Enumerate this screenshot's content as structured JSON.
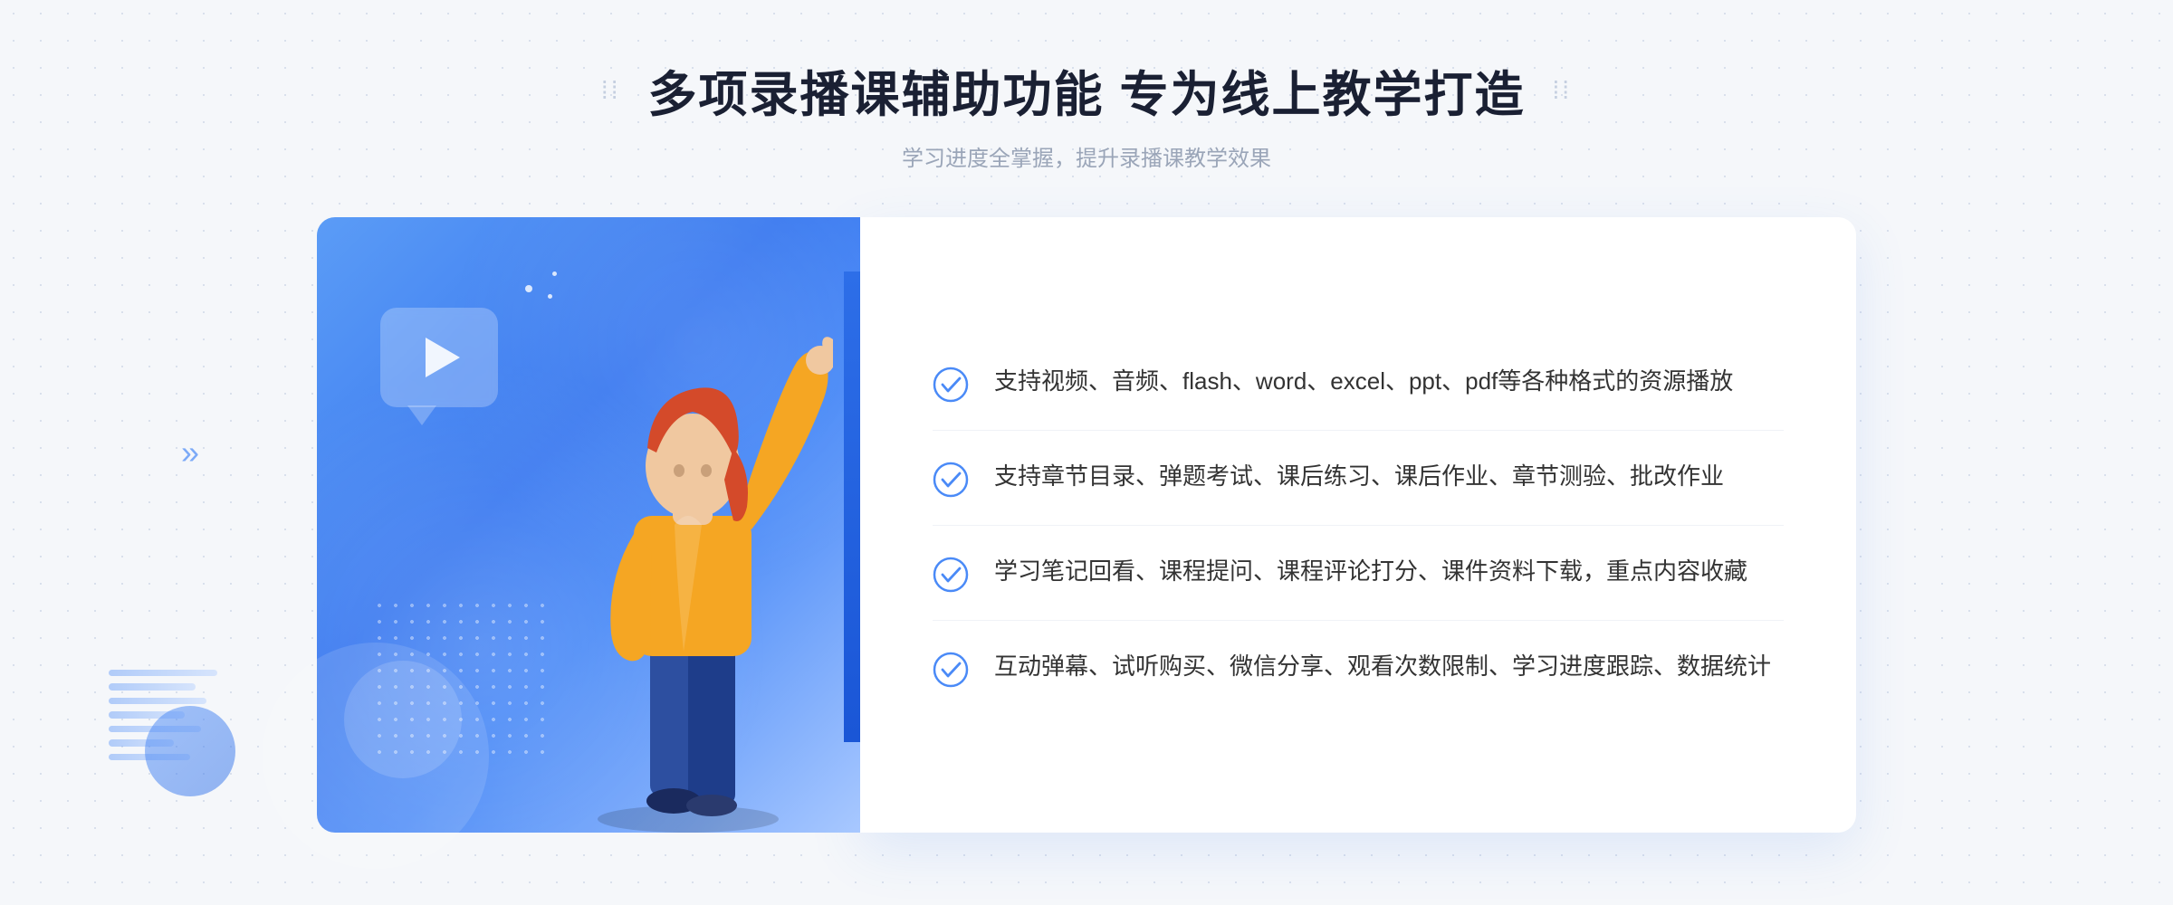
{
  "page": {
    "background_color": "#f5f7fa"
  },
  "header": {
    "decorator_left": "⁞⁞",
    "decorator_right": "⁞⁞",
    "main_title": "多项录播课辅助功能 专为线上教学打造",
    "sub_title": "学习进度全掌握，提升录播课教学效果"
  },
  "features": [
    {
      "id": 1,
      "text": "支持视频、音频、flash、word、excel、ppt、pdf等各种格式的资源播放"
    },
    {
      "id": 2,
      "text": "支持章节目录、弹题考试、课后练习、课后作业、章节测验、批改作业"
    },
    {
      "id": 3,
      "text": "学习笔记回看、课程提问、课程评论打分、课件资料下载，重点内容收藏"
    },
    {
      "id": 4,
      "text": "互动弹幕、试听购买、微信分享、观看次数限制、学习进度跟踪、数据统计"
    }
  ],
  "left_arrow": "»",
  "check_icon_color": "#4a8af7"
}
